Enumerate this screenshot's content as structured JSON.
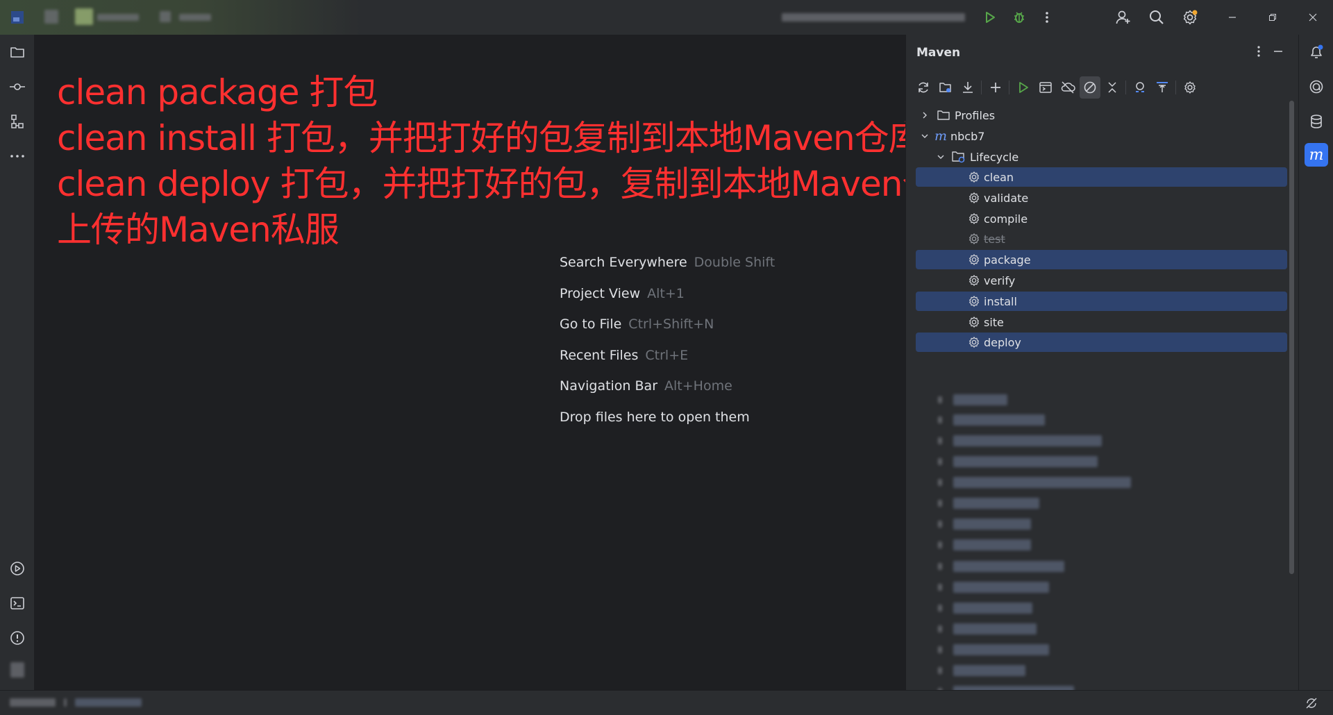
{
  "annotation": {
    "lines": [
      "clean package 打包",
      "clean install 打包，并把打好的包复制到本地Maven仓库",
      "clean deploy 打包，并把打好的包，复制到本地Maven仓库，",
      "上传的Maven私服"
    ]
  },
  "tips": [
    {
      "label": "Search Everywhere",
      "key": "Double Shift"
    },
    {
      "label": "Project View",
      "key": "Alt+1"
    },
    {
      "label": "Go to File",
      "key": "Ctrl+Shift+N"
    },
    {
      "label": "Recent Files",
      "key": "Ctrl+E"
    },
    {
      "label": "Navigation Bar",
      "key": "Alt+Home"
    },
    {
      "label": "Drop files here to open them",
      "key": ""
    }
  ],
  "maven": {
    "title": "Maven",
    "tree": {
      "profiles": "Profiles",
      "project": "nbcb7",
      "project_badge": "m",
      "lifecycle": "Lifecycle",
      "phases": [
        "clean",
        "validate",
        "compile",
        "test",
        "package",
        "verify",
        "install",
        "site",
        "deploy"
      ]
    }
  },
  "right_stripe": {
    "maven_badge": "m"
  },
  "colors": {
    "annotation": "#ff3030",
    "selection": "#2e436e",
    "run_green": "#57a64a",
    "accent_blue": "#3574f0"
  }
}
